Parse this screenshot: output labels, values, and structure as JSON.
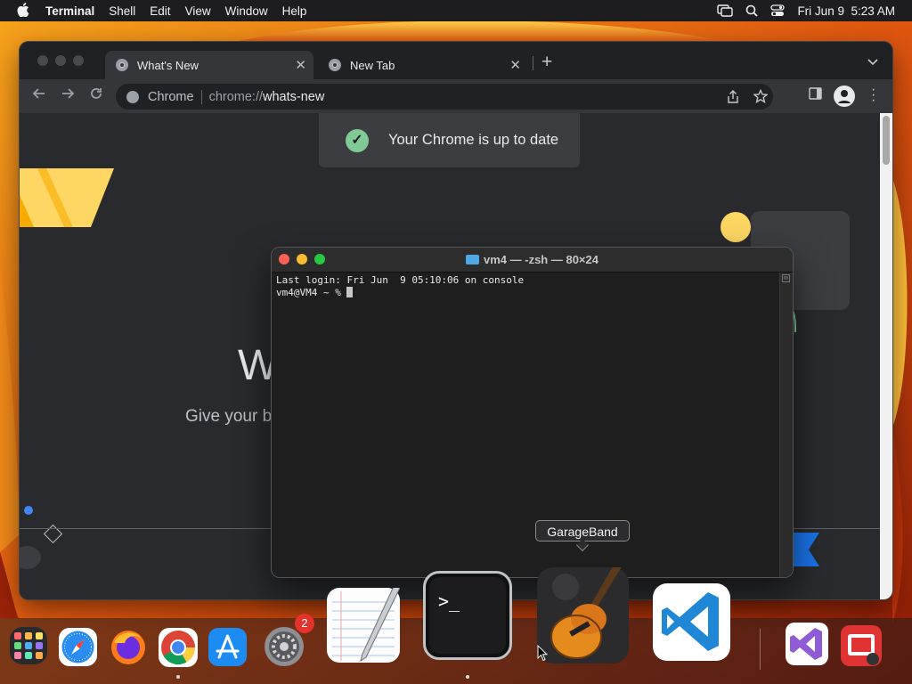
{
  "menubar": {
    "app_name": "Terminal",
    "items": [
      "Shell",
      "Edit",
      "View",
      "Window",
      "Help"
    ],
    "datetime": "Fri Jun 9  5:23 AM"
  },
  "chrome": {
    "tabs": [
      {
        "label": "What's New",
        "active": true
      },
      {
        "label": "New Tab",
        "active": false
      }
    ],
    "omnibox": {
      "site_label": "Chrome",
      "url_scheme": "chrome://",
      "url_host": "whats-new"
    },
    "toast": "Your Chrome is up to date",
    "page": {
      "heading_partial": "W",
      "subtitle_partial": "Give your b"
    }
  },
  "terminal": {
    "title": "vm4 — -zsh — 80×24",
    "lines": [
      "Last login: Fri Jun  9 05:10:06 on console",
      "vm4@VM4 ~ % "
    ]
  },
  "dock": {
    "tooltip": "GarageBand",
    "system_settings_badge": "2",
    "apps": [
      "Launchpad",
      "Safari",
      "Firefox",
      "Google Chrome",
      "App Store",
      "System Settings",
      "TextEdit",
      "Terminal",
      "GarageBand",
      "Visual Studio Code",
      "Visual Studio",
      "Photo Booth"
    ]
  }
}
